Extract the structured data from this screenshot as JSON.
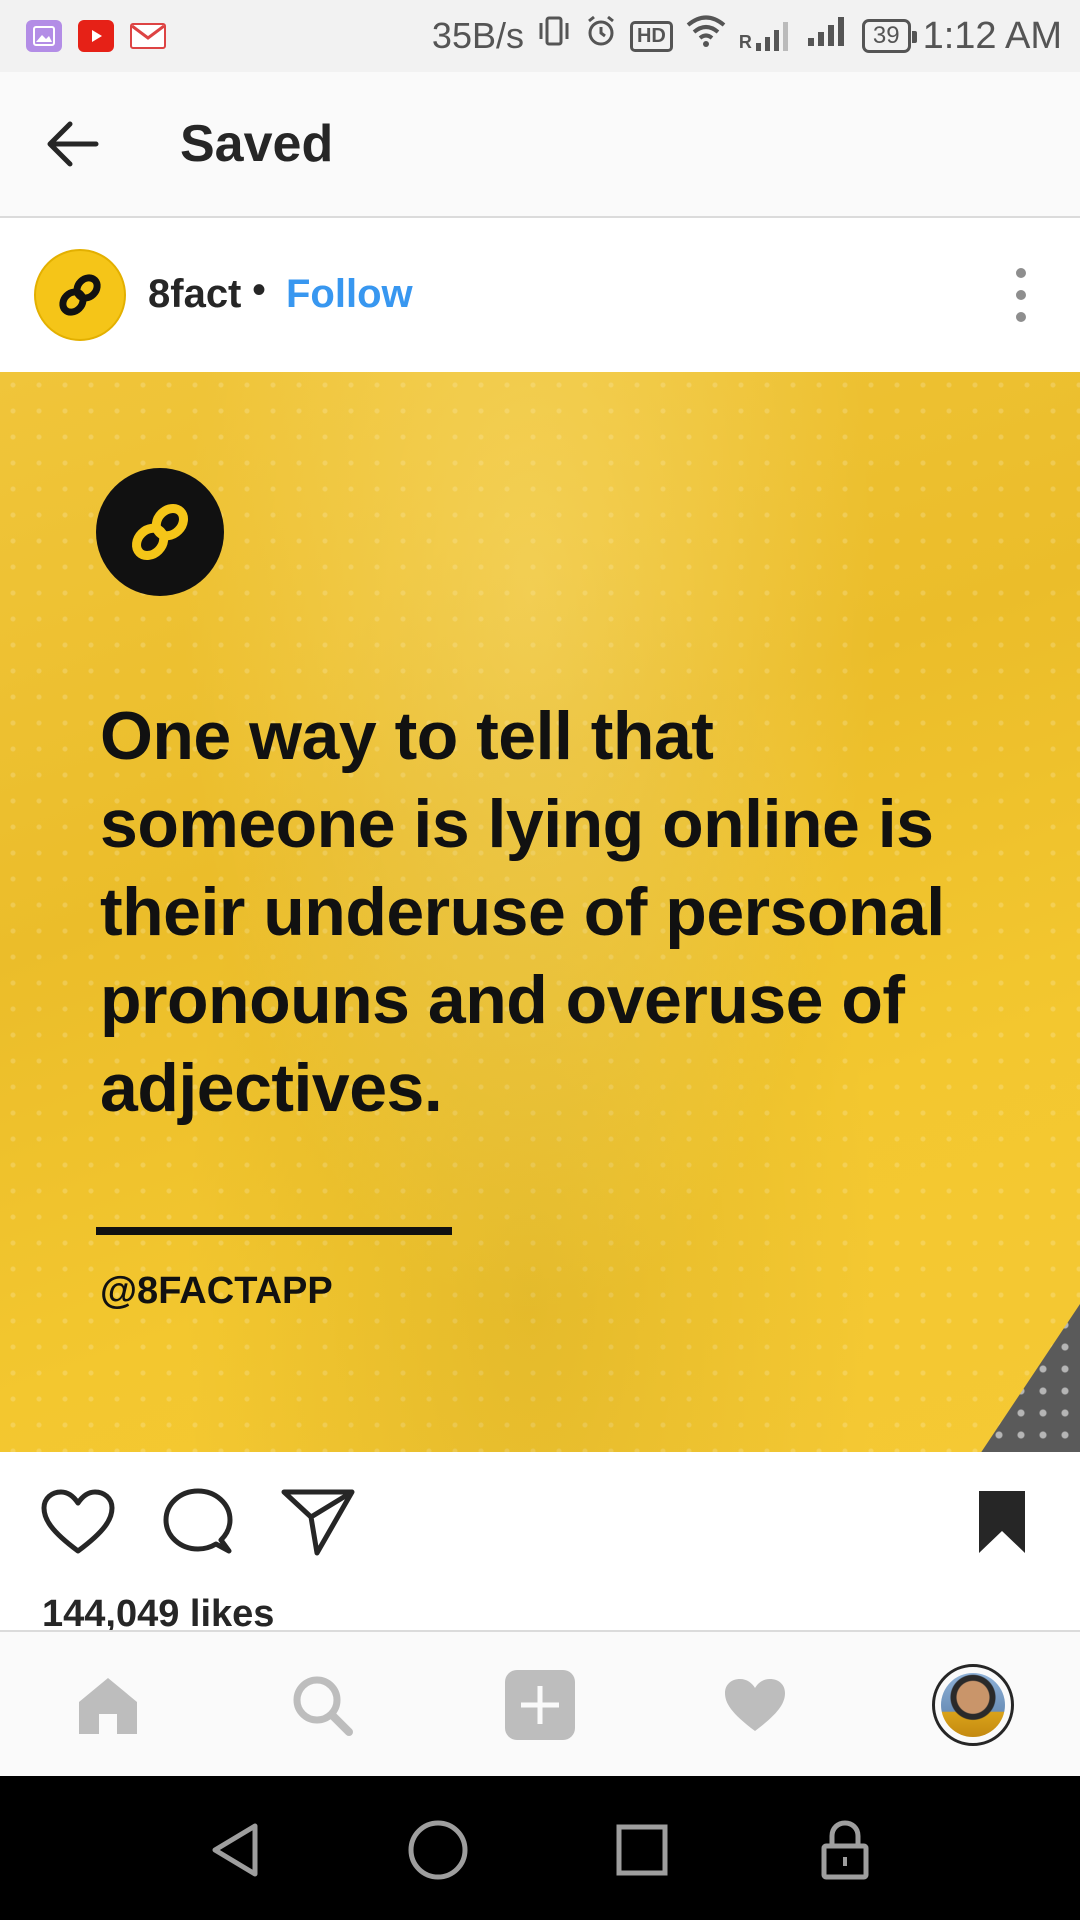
{
  "status_bar": {
    "net_speed": "35B/s",
    "hd_label": "HD",
    "signal_label": "R",
    "battery": "39",
    "time": "1:12 AM"
  },
  "header": {
    "title": "Saved"
  },
  "post": {
    "username": "8fact",
    "separator": "•",
    "follow_label": "Follow",
    "image": {
      "quote": "One way to tell that someone is lying online is their underuse of personal pronouns and overuse of adjectives.",
      "handle": "@8FACTAPP"
    },
    "likes": "144,049 likes"
  },
  "colors": {
    "accent_follow": "#3897f0",
    "brand_yellow": "#f5c518"
  }
}
